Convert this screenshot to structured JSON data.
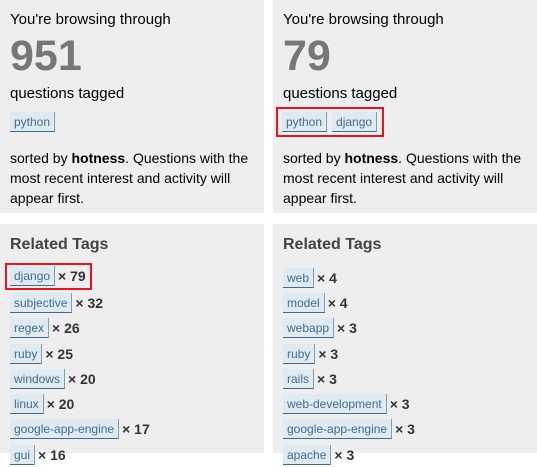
{
  "left": {
    "browsing_text": "You're browsing through",
    "count": "951",
    "questions_tagged": "questions tagged",
    "tags": [
      "python"
    ],
    "sorted_prefix": "sorted by ",
    "sorted_bold": "hotness",
    "sorted_suffix": ". Questions with the most recent interest and activity will appear first.",
    "related_title": "Related Tags",
    "related": [
      {
        "tag": "django",
        "count": "× 79"
      },
      {
        "tag": "subjective",
        "count": "× 32"
      },
      {
        "tag": "regex",
        "count": "× 26"
      },
      {
        "tag": "ruby",
        "count": "× 25"
      },
      {
        "tag": "windows",
        "count": "× 20"
      },
      {
        "tag": "linux",
        "count": "× 20"
      },
      {
        "tag": "google-app-engine",
        "count": "× 17"
      },
      {
        "tag": "gui",
        "count": "× 16"
      }
    ]
  },
  "right": {
    "browsing_text": "You're browsing through",
    "count": "79",
    "questions_tagged": "questions tagged",
    "tags": [
      "python",
      "django"
    ],
    "sorted_prefix": "sorted by ",
    "sorted_bold": "hotness",
    "sorted_suffix": ". Questions with the most recent interest and activity will appear first.",
    "related_title": "Related Tags",
    "related": [
      {
        "tag": "web",
        "count": "× 4"
      },
      {
        "tag": "model",
        "count": "× 4"
      },
      {
        "tag": "webapp",
        "count": "× 3"
      },
      {
        "tag": "ruby",
        "count": "× 3"
      },
      {
        "tag": "rails",
        "count": "× 3"
      },
      {
        "tag": "web-development",
        "count": "× 3"
      },
      {
        "tag": "google-app-engine",
        "count": "× 3"
      },
      {
        "tag": "apache",
        "count": "× 3"
      }
    ]
  },
  "colors": {
    "panel_bg": "#eeeeee",
    "tag_text": "#3e6d8e",
    "tag_bg": "#e0eaf1",
    "highlight": "#e8141e",
    "count_gray": "#777777"
  }
}
